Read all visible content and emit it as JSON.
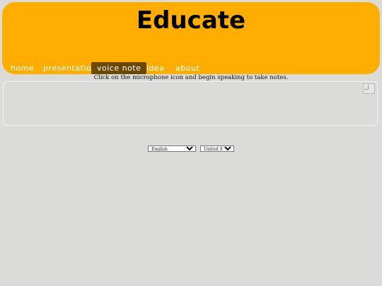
{
  "header": {
    "brand": "Educate",
    "nav": [
      {
        "label": "home",
        "active": false
      },
      {
        "label": "presentation",
        "active": false
      },
      {
        "label": "voice note",
        "active": true
      },
      {
        "label": "idea",
        "active": false
      },
      {
        "label": "about",
        "active": false
      }
    ]
  },
  "main": {
    "instruction": "Click on the microphone icon and begin speaking to take notes.",
    "mic_icon": "microphone-icon"
  },
  "language": {
    "selected": "English",
    "options": [
      "English"
    ]
  },
  "dialect": {
    "selected": "United States",
    "options": [
      "United States"
    ]
  },
  "colors": {
    "background": "#dcdcd6",
    "header": "#ffae00",
    "nav_active": "#6a4800",
    "nav_text": "#ffffff"
  }
}
